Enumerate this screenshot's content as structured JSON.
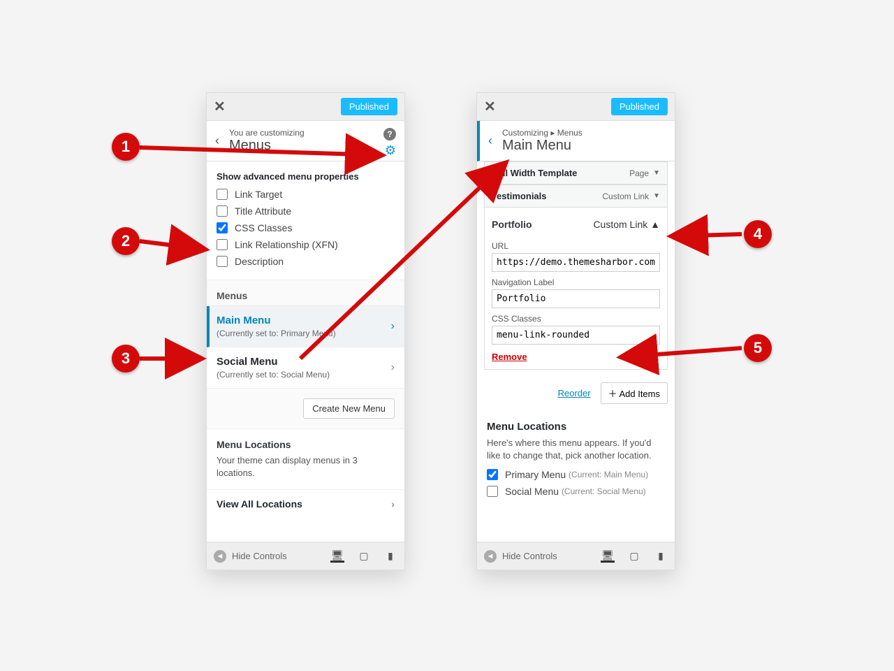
{
  "top": {
    "publish": "Published"
  },
  "panelA": {
    "head_small": "You are customizing",
    "head_big": "Menus",
    "adv_title": "Show advanced menu properties",
    "opts": {
      "link_target": "Link Target",
      "title_attr": "Title Attribute",
      "css_classes": "CSS Classes",
      "link_rel": "Link Relationship (XFN)",
      "description": "Description"
    },
    "menus_label": "Menus",
    "main_menu": {
      "title": "Main Menu",
      "sub": "(Currently set to: Primary Menu)"
    },
    "social_menu": {
      "title": "Social Menu",
      "sub": "(Currently set to: Social Menu)"
    },
    "create_btn": "Create New Menu",
    "loc_label": "Menu Locations",
    "loc_desc": "Your theme can display menus in 3 locations.",
    "view_all": "View All Locations",
    "footer_hide": "Hide Controls"
  },
  "panelB": {
    "head_small": "Customizing ▸ Menus",
    "head_big": "Main Menu",
    "items": [
      {
        "name": "Full Width Template",
        "type": "Page"
      },
      {
        "name": "Testimonials",
        "type": "Custom Link"
      }
    ],
    "open_item": {
      "name": "Portfolio",
      "type": "Custom Link",
      "url_label": "URL",
      "url": "https://demo.themesharbor.com",
      "nav_label_label": "Navigation Label",
      "nav_label": "Portfolio",
      "css_label": "CSS Classes",
      "css": "menu-link-rounded",
      "remove": "Remove"
    },
    "reorder": "Reorder",
    "add_items": "Add Items",
    "loc_hdr": "Menu Locations",
    "loc_desc": "Here's where this menu appears. If you'd like to change that, pick another location.",
    "primary": {
      "label": "Primary Menu",
      "note": "(Current: Main Menu)"
    },
    "social": {
      "label": "Social Menu",
      "note": "(Current: Social Menu)"
    },
    "footer_hide": "Hide Controls"
  },
  "badges": {
    "b1": "1",
    "b2": "2",
    "b3": "3",
    "b4": "4",
    "b5": "5"
  }
}
